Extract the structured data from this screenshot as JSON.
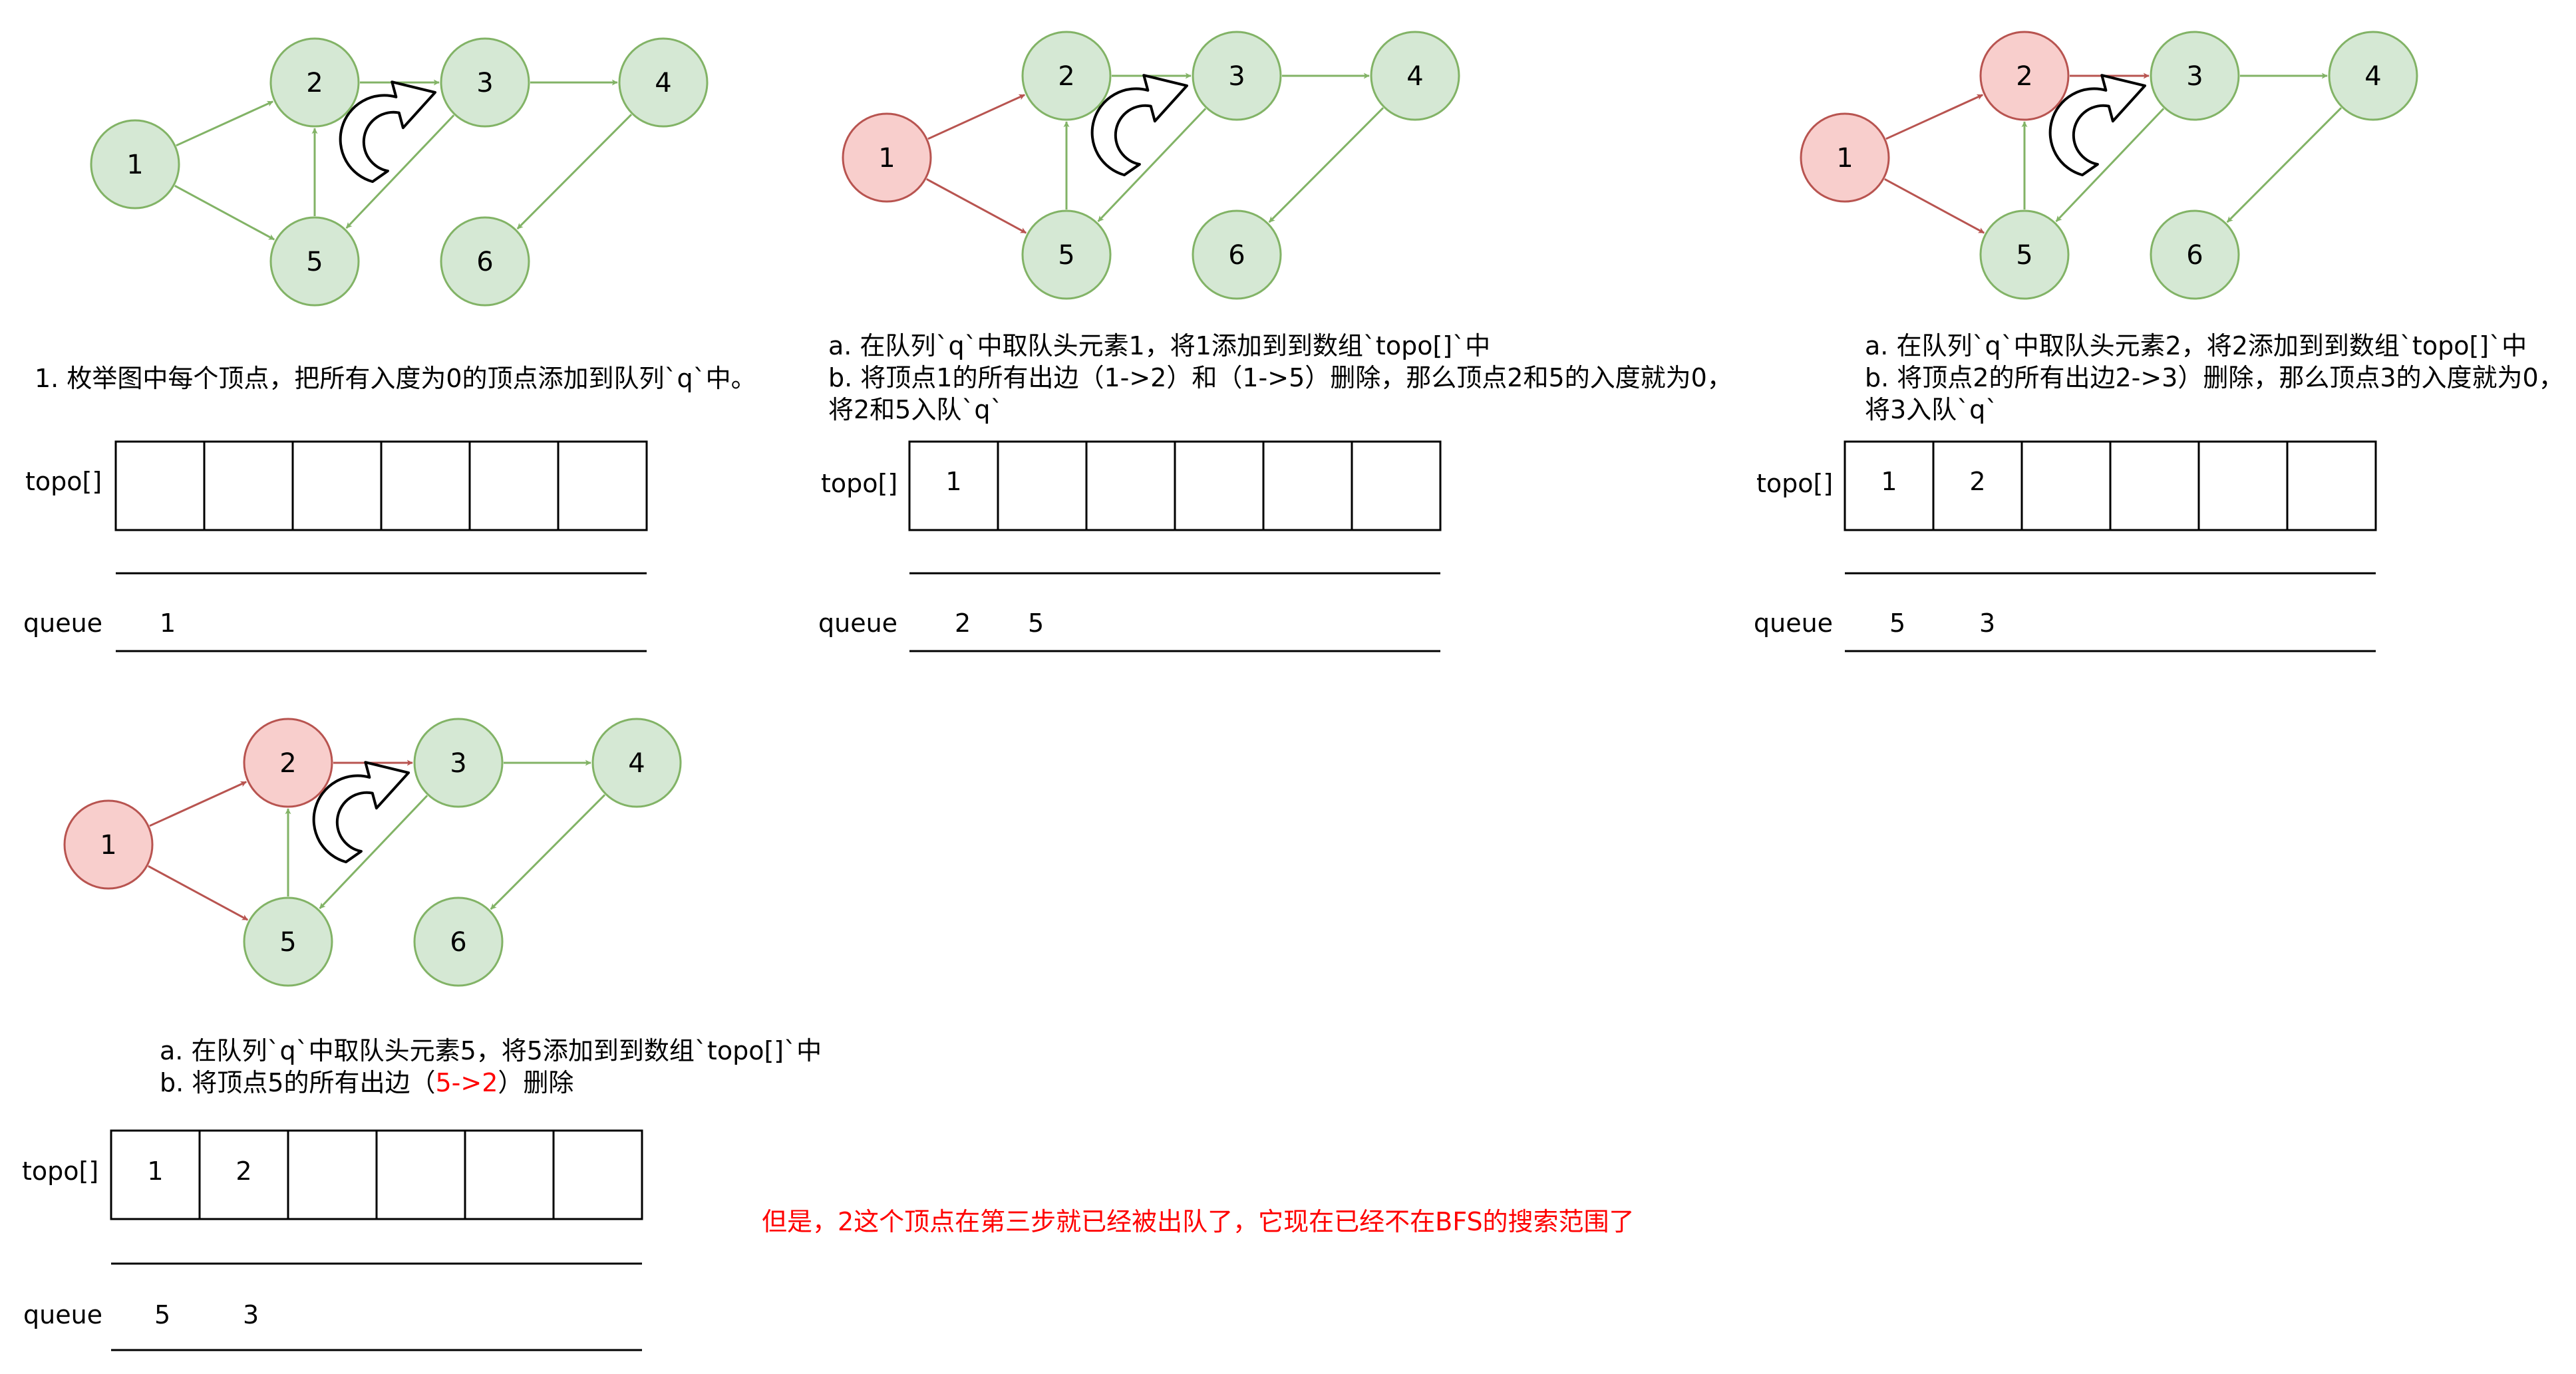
{
  "colors": {
    "node_fill": "#d5e8d4",
    "node_stroke": "#82b366",
    "node_removed_fill": "#f8cecc",
    "node_removed_stroke": "#b85450",
    "edge_green": "#82b366",
    "edge_red": "#b85450",
    "note": "#ff0000",
    "line": "#000000"
  },
  "icons": {
    "cycle_marker": "circular-arrow-icon"
  },
  "panels": [
    {
      "id": "step1",
      "nodes": [
        {
          "id": "1",
          "state": "active"
        },
        {
          "id": "2",
          "state": "active"
        },
        {
          "id": "3",
          "state": "active"
        },
        {
          "id": "4",
          "state": "active"
        },
        {
          "id": "5",
          "state": "active"
        },
        {
          "id": "6",
          "state": "active"
        }
      ],
      "edges": [
        {
          "from": "1",
          "to": "2",
          "state": "active"
        },
        {
          "from": "1",
          "to": "5",
          "state": "active"
        },
        {
          "from": "2",
          "to": "3",
          "state": "active"
        },
        {
          "from": "3",
          "to": "4",
          "state": "active"
        },
        {
          "from": "3",
          "to": "5",
          "state": "active"
        },
        {
          "from": "5",
          "to": "2",
          "state": "active"
        },
        {
          "from": "4",
          "to": "6",
          "state": "active"
        }
      ],
      "caption_lines": [
        "1. 枚举图中每个顶点，把所有入度为0的顶点添加到队列`q`中。"
      ],
      "topo_label": "topo[]",
      "topo": [
        "",
        "",
        "",
        "",
        "",
        ""
      ],
      "queue_label": "queue",
      "queue": [
        "1"
      ]
    },
    {
      "id": "step2",
      "nodes": [
        {
          "id": "1",
          "state": "removed"
        },
        {
          "id": "2",
          "state": "active"
        },
        {
          "id": "3",
          "state": "active"
        },
        {
          "id": "4",
          "state": "active"
        },
        {
          "id": "5",
          "state": "active"
        },
        {
          "id": "6",
          "state": "active"
        }
      ],
      "edges": [
        {
          "from": "1",
          "to": "2",
          "state": "removed"
        },
        {
          "from": "1",
          "to": "5",
          "state": "removed"
        },
        {
          "from": "2",
          "to": "3",
          "state": "active"
        },
        {
          "from": "3",
          "to": "4",
          "state": "active"
        },
        {
          "from": "3",
          "to": "5",
          "state": "active"
        },
        {
          "from": "5",
          "to": "2",
          "state": "active"
        },
        {
          "from": "4",
          "to": "6",
          "state": "active"
        }
      ],
      "caption_lines": [
        "a. 在队列`q`中取队头元素1，将1添加到到数组`topo[]`中",
        "b. 将顶点1的所有出边（1->2）和（1->5）删除，那么顶点2和5的入度就为0，",
        "将2和5入队`q`"
      ],
      "topo_label": "topo[]",
      "topo": [
        "1",
        "",
        "",
        "",
        "",
        ""
      ],
      "queue_label": "queue",
      "queue": [
        "2",
        "5"
      ]
    },
    {
      "id": "step3",
      "nodes": [
        {
          "id": "1",
          "state": "removed"
        },
        {
          "id": "2",
          "state": "removed"
        },
        {
          "id": "3",
          "state": "active"
        },
        {
          "id": "4",
          "state": "active"
        },
        {
          "id": "5",
          "state": "active"
        },
        {
          "id": "6",
          "state": "active"
        }
      ],
      "edges": [
        {
          "from": "1",
          "to": "2",
          "state": "removed"
        },
        {
          "from": "1",
          "to": "5",
          "state": "removed"
        },
        {
          "from": "2",
          "to": "3",
          "state": "removed"
        },
        {
          "from": "3",
          "to": "4",
          "state": "active"
        },
        {
          "from": "3",
          "to": "5",
          "state": "active"
        },
        {
          "from": "5",
          "to": "2",
          "state": "active"
        },
        {
          "from": "4",
          "to": "6",
          "state": "active"
        }
      ],
      "caption_lines": [
        "a. 在队列`q`中取队头元素2，将2添加到到数组`topo[]`中",
        "b. 将顶点2的所有出边2->3）删除，那么顶点3的入度就为0，",
        "将3入队`q`"
      ],
      "topo_label": "topo[]",
      "topo": [
        "1",
        "2",
        "",
        "",
        "",
        ""
      ],
      "queue_label": "queue",
      "queue": [
        "5",
        "3"
      ]
    },
    {
      "id": "step4",
      "nodes": [
        {
          "id": "1",
          "state": "removed"
        },
        {
          "id": "2",
          "state": "removed"
        },
        {
          "id": "3",
          "state": "active"
        },
        {
          "id": "4",
          "state": "active"
        },
        {
          "id": "5",
          "state": "active"
        },
        {
          "id": "6",
          "state": "active"
        }
      ],
      "edges": [
        {
          "from": "1",
          "to": "2",
          "state": "removed"
        },
        {
          "from": "1",
          "to": "5",
          "state": "removed"
        },
        {
          "from": "2",
          "to": "3",
          "state": "removed"
        },
        {
          "from": "3",
          "to": "4",
          "state": "active"
        },
        {
          "from": "3",
          "to": "5",
          "state": "active"
        },
        {
          "from": "5",
          "to": "2",
          "state": "active"
        },
        {
          "from": "4",
          "to": "6",
          "state": "active"
        }
      ],
      "caption_lines": [
        "a. 在队列`q`中取队头元素5，将5添加到到数组`topo[]`中"
      ],
      "caption_line2": {
        "prefix": "b. 将顶点5的所有出边（",
        "highlight": "5->2",
        "suffix": "）删除"
      },
      "topo_label": "topo[]",
      "topo": [
        "1",
        "2",
        "",
        "",
        "",
        ""
      ],
      "queue_label": "queue",
      "queue": [
        "5",
        "3"
      ]
    }
  ],
  "note": "但是，2这个顶点在第三步就已经被出队了，它现在已经不在BFS的搜索范围了"
}
